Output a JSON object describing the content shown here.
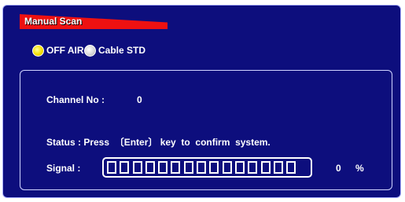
{
  "header": {
    "title": "Manual Scan"
  },
  "mode_options": [
    {
      "label": "OFF AIR",
      "selected": true
    },
    {
      "label": "Cable STD",
      "selected": false
    }
  ],
  "channel": {
    "label": "Channel No :",
    "value": "0"
  },
  "status": {
    "text": "Status : Press  〔Enter〕 key  to  confirm  system."
  },
  "signal": {
    "label": "Signal :",
    "segment_count": 15,
    "level_percent": 0,
    "value_text": "0",
    "unit": "%"
  },
  "colors": {
    "background": "#0d0e7d",
    "accent": "#ee1111",
    "radio_on": "#f5e000",
    "radio_off": "#d9d9d9"
  }
}
